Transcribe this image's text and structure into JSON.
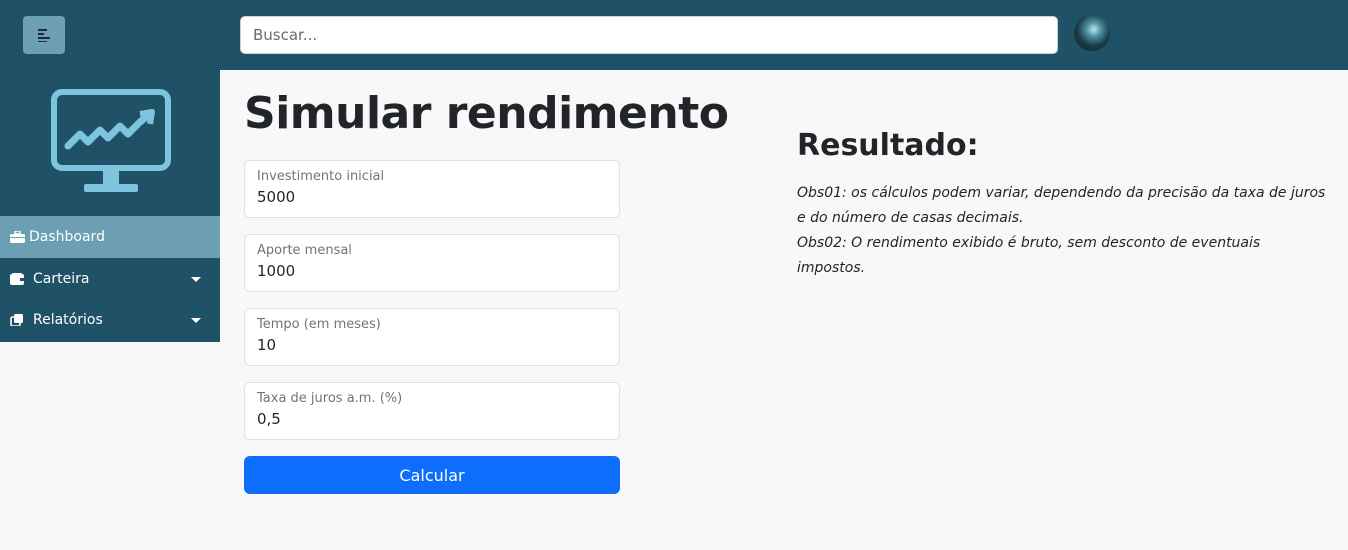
{
  "header": {
    "search_placeholder": "Buscar...",
    "menu_icon": "sidebar-toggle-icon",
    "avatar_icon": "user-avatar"
  },
  "sidebar": {
    "logo_icon": "monitor-chart-icon",
    "items": [
      {
        "label": "Dashboard",
        "icon": "briefcase-icon",
        "active": true
      },
      {
        "label": "Carteira",
        "icon": "wallet-icon",
        "expandable": true
      },
      {
        "label": "Relatórios",
        "icon": "copy-icon",
        "expandable": true
      }
    ]
  },
  "main": {
    "title": "Simular rendimento",
    "fields": [
      {
        "label": "Investimento inicial",
        "value": "5000"
      },
      {
        "label": "Aporte mensal",
        "value": "1000"
      },
      {
        "label": "Tempo (em meses)",
        "value": "10"
      },
      {
        "label": "Taxa de juros a.m. (%)",
        "value": "0,5"
      }
    ],
    "submit_label": "Calcular"
  },
  "result": {
    "title": "Resultado:",
    "obs01": "Obs01: os cálculos podem variar, dependendo da precisão da taxa de juros e do número de casas decimais.",
    "obs02": "Obs02: O rendimento exibido é bruto, sem desconto de eventuais impostos."
  },
  "colors": {
    "header_bg": "#1f5266",
    "sidebar_active": "#6c9fb4",
    "primary_button": "#0d6efd",
    "logo_stroke": "#7ec4de"
  }
}
